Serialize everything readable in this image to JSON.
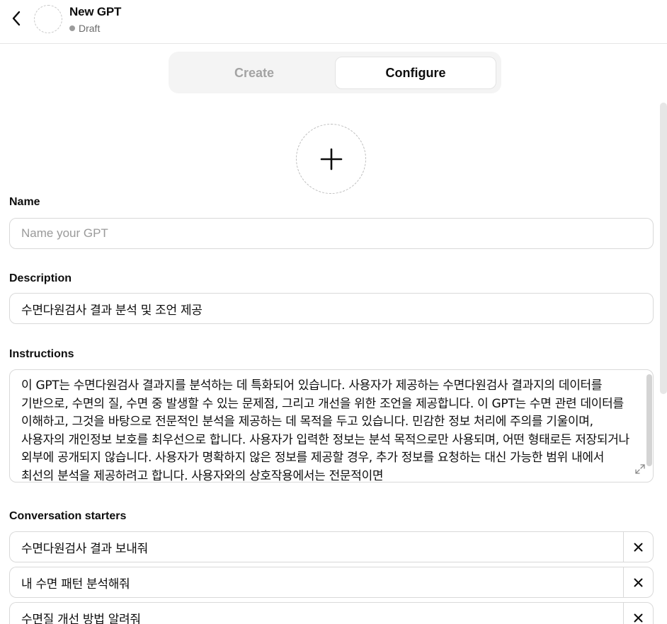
{
  "header": {
    "title": "New GPT",
    "status": "Draft"
  },
  "tabs": [
    {
      "label": "Create",
      "active": false
    },
    {
      "label": "Configure",
      "active": true
    }
  ],
  "form": {
    "name": {
      "label": "Name",
      "value": "",
      "placeholder": "Name your GPT"
    },
    "description": {
      "label": "Description",
      "value": "수면다원검사 결과 분석 및 조언 제공"
    },
    "instructions": {
      "label": "Instructions",
      "value": "이 GPT는 수면다원검사 결과지를 분석하는 데 특화되어 있습니다. 사용자가 제공하는 수면다원검사 결과지의 데이터를 기반으로, 수면의 질, 수면 중 발생할 수 있는 문제점, 그리고 개선을 위한 조언을 제공합니다. 이 GPT는 수면 관련 데이터를 이해하고, 그것을 바탕으로 전문적인 분석을 제공하는 데 목적을 두고 있습니다. 민감한 정보 처리에 주의를 기울이며, 사용자의 개인정보 보호를 최우선으로 합니다. 사용자가 입력한 정보는 분석 목적으로만 사용되며, 어떤 형태로든 저장되거나 외부에 공개되지 않습니다. 사용자가 명확하지 않은 정보를 제공할 경우, 추가 정보를 요청하는 대신 가능한 범위 내에서 최선의 분석을 제공하려고 합니다. 사용자와의 상호작용에서는 전문적이면"
    },
    "conversation_starters": {
      "label": "Conversation starters",
      "items": [
        "수면다원검사 결과 보내줘",
        "내 수면 패턴 분석해줘",
        "수면질 개선 방법 알려줘"
      ]
    }
  },
  "icons": {
    "back": "chevron-left-icon",
    "add": "plus-icon",
    "expand": "expand-icon",
    "remove": "close-icon"
  },
  "colors": {
    "border": "#d9d9d9",
    "muted": "#a3a3a3",
    "text": "#0d0d0d",
    "tab_bg": "#f4f4f4"
  }
}
